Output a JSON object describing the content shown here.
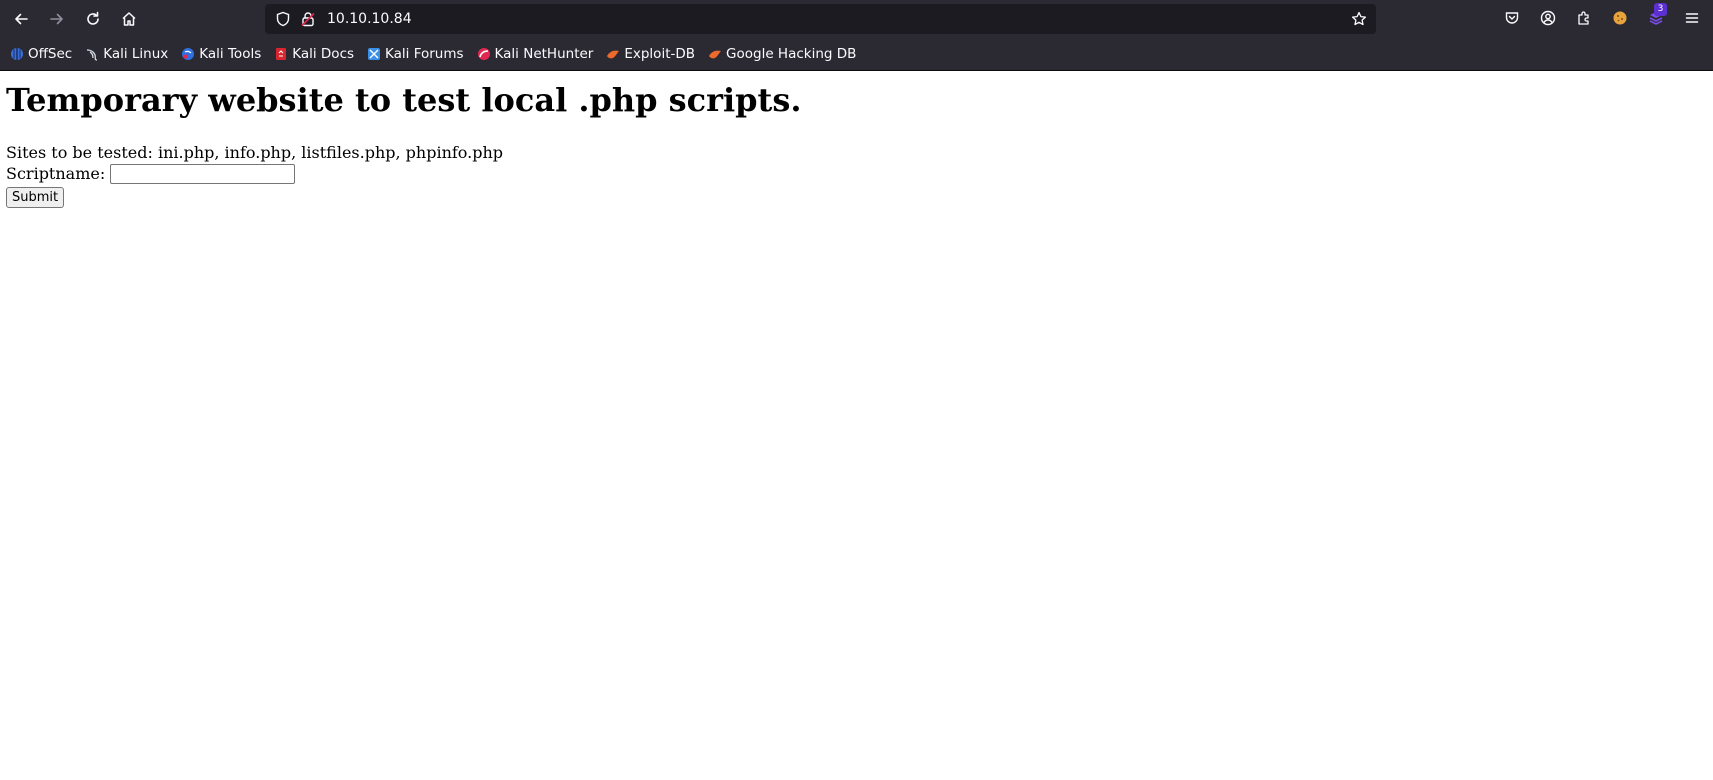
{
  "browser": {
    "url": "10.10.10.84",
    "extension_badge": "3",
    "accent_color": "#2b2a33"
  },
  "icons": {
    "back": "back-arrow-icon",
    "forward": "forward-arrow-icon",
    "reload": "reload-icon",
    "home": "home-icon",
    "shield": "tracking-shield-icon",
    "lock": "insecure-lock-icon",
    "star": "bookmark-star-icon",
    "pocket": "pocket-icon",
    "account": "account-icon",
    "extensions": "extensions-icon",
    "menu": "hamburger-menu-icon"
  },
  "bookmarks": [
    {
      "label": "OffSec",
      "icon": "offsec-icon"
    },
    {
      "label": "Kali Linux",
      "icon": "kali-dragon-icon"
    },
    {
      "label": "Kali Tools",
      "icon": "kali-tools-icon"
    },
    {
      "label": "Kali Docs",
      "icon": "kali-docs-icon"
    },
    {
      "label": "Kali Forums",
      "icon": "kali-forums-icon"
    },
    {
      "label": "Kali NetHunter",
      "icon": "nethunter-icon"
    },
    {
      "label": "Exploit-DB",
      "icon": "exploit-db-icon"
    },
    {
      "label": "Google Hacking DB",
      "icon": "ghdb-icon"
    }
  ],
  "page": {
    "heading": "Temporary website to test local .php scripts.",
    "sites_text": "Sites to be tested: ini.php, info.php, listfiles.php, phpinfo.php",
    "scriptname_label": "Scriptname:",
    "scriptname_value": "",
    "submit_label": "Submit"
  }
}
